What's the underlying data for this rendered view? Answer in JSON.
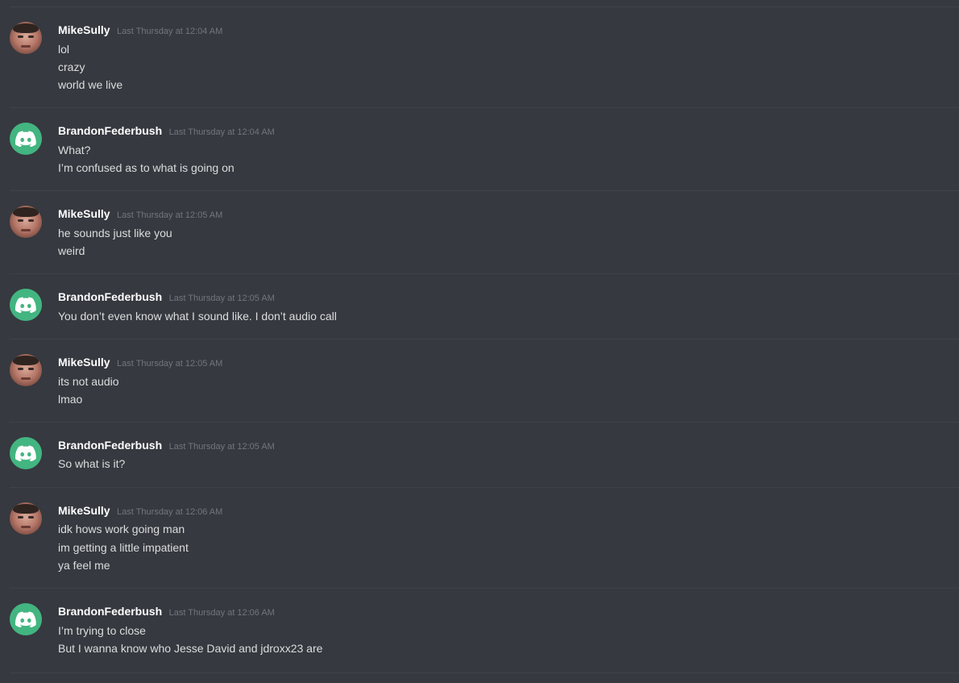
{
  "messages": [
    {
      "author": "MikeSully",
      "avatar": "photo-avatar",
      "timestamp": "Last Thursday at 12:04 AM",
      "lines": [
        "lol",
        "crazy",
        "world we live"
      ]
    },
    {
      "author": "BrandonFederbush",
      "avatar": "discord-logo-avatar",
      "timestamp": "Last Thursday at 12:04 AM",
      "lines": [
        "What?",
        "I’m confused as to what is going on"
      ]
    },
    {
      "author": "MikeSully",
      "avatar": "photo-avatar",
      "timestamp": "Last Thursday at 12:05 AM",
      "lines": [
        "he sounds just like you",
        "weird"
      ]
    },
    {
      "author": "BrandonFederbush",
      "avatar": "discord-logo-avatar",
      "timestamp": "Last Thursday at 12:05 AM",
      "lines": [
        "You don’t even know what I sound like. I don’t audio call"
      ]
    },
    {
      "author": "MikeSully",
      "avatar": "photo-avatar",
      "timestamp": "Last Thursday at 12:05 AM",
      "lines": [
        "its not audio",
        "lmao"
      ]
    },
    {
      "author": "BrandonFederbush",
      "avatar": "discord-logo-avatar",
      "timestamp": "Last Thursday at 12:05 AM",
      "lines": [
        "So what is it?"
      ]
    },
    {
      "author": "MikeSully",
      "avatar": "photo-avatar",
      "timestamp": "Last Thursday at 12:06 AM",
      "lines": [
        "idk hows work going man",
        "im getting a little impatient",
        "ya feel me"
      ]
    },
    {
      "author": "BrandonFederbush",
      "avatar": "discord-logo-avatar",
      "timestamp": "Last Thursday at 12:06 AM",
      "lines": [
        "I’m trying to close",
        "But I wanna know who Jesse David and jdroxx23 are"
      ]
    }
  ],
  "colors": {
    "background": "#36393f",
    "username": "#ffffff",
    "message_text": "#dcddde",
    "timestamp": "#72767d",
    "discord_avatar": "#43b581"
  }
}
